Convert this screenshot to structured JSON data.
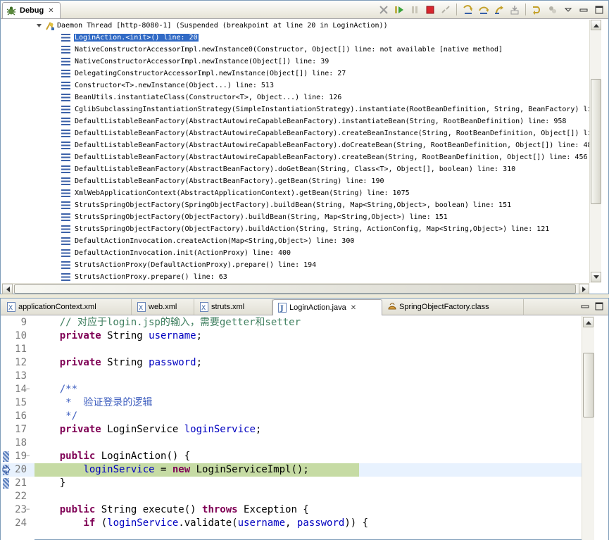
{
  "debug": {
    "tab_label": "Debug",
    "thread_label": "Daemon Thread [http-8080-1] (Suspended (breakpoint at line 20 in LoginAction))",
    "frames": [
      "LoginAction.<init>() line: 20",
      "NativeConstructorAccessorImpl.newInstance0(Constructor, Object[]) line: not available [native method]",
      "NativeConstructorAccessorImpl.newInstance(Object[]) line: 39",
      "DelegatingConstructorAccessorImpl.newInstance(Object[]) line: 27",
      "Constructor<T>.newInstance(Object...) line: 513",
      "BeanUtils.instantiateClass(Constructor<T>, Object...) line: 126",
      "CglibSubclassingInstantiationStrategy(SimpleInstantiationStrategy).instantiate(RootBeanDefinition, String, BeanFactory) li",
      "DefaultListableBeanFactory(AbstractAutowireCapableBeanFactory).instantiateBean(String, RootBeanDefinition) line: 958",
      "DefaultListableBeanFactory(AbstractAutowireCapableBeanFactory).createBeanInstance(String, RootBeanDefinition, Object[]) li",
      "DefaultListableBeanFactory(AbstractAutowireCapableBeanFactory).doCreateBean(String, RootBeanDefinition, Object[]) line: 48",
      "DefaultListableBeanFactory(AbstractAutowireCapableBeanFactory).createBean(String, RootBeanDefinition, Object[]) line: 456",
      "DefaultListableBeanFactory(AbstractBeanFactory).doGetBean(String, Class<T>, Object[], boolean) line: 310",
      "DefaultListableBeanFactory(AbstractBeanFactory).getBean(String) line: 190",
      "XmlWebApplicationContext(AbstractApplicationContext).getBean(String) line: 1075",
      "StrutsSpringObjectFactory(SpringObjectFactory).buildBean(String, Map<String,Object>, boolean) line: 151",
      "StrutsSpringObjectFactory(ObjectFactory).buildBean(String, Map<String,Object>) line: 151",
      "StrutsSpringObjectFactory(ObjectFactory).buildAction(String, String, ActionConfig, Map<String,Object>) line: 121",
      "DefaultActionInvocation.createAction(Map<String,Object>) line: 300",
      "DefaultActionInvocation.init(ActionProxy) line: 400",
      "StrutsActionProxy(DefaultActionProxy).prepare() line: 194",
      "StrutsActionProxy.prepare() line: 63"
    ],
    "selected_index": 0,
    "toolbar": [
      "remove-terminated-icon",
      "resume-icon",
      "suspend-icon",
      "terminate-icon",
      "disconnect-icon",
      "step-into-icon",
      "step-over-icon",
      "step-return-icon",
      "drop-to-frame-icon",
      "use-step-filters-icon",
      "view-menu-icon",
      "minimize-icon",
      "maximize-icon"
    ]
  },
  "editor": {
    "tabs": [
      {
        "label": "applicationContext.xml",
        "icon": "xml-file-icon",
        "active": false
      },
      {
        "label": "web.xml",
        "icon": "xml-file-icon",
        "active": false
      },
      {
        "label": "struts.xml",
        "icon": "xml-file-icon",
        "active": false
      },
      {
        "label": "LoginAction.java",
        "icon": "java-file-icon",
        "active": true
      },
      {
        "label": "SpringObjectFactory.class",
        "icon": "class-file-icon",
        "active": false
      }
    ],
    "lines": [
      {
        "num": "9",
        "tokens": [
          [
            "cmt",
            "    // 对应于login.jsp的输入，需要getter和setter"
          ]
        ]
      },
      {
        "num": "10",
        "tokens": [
          [
            "kw",
            "    private"
          ],
          [
            "plain",
            " String "
          ],
          [
            "fld",
            "username"
          ],
          [
            "plain",
            ";"
          ]
        ]
      },
      {
        "num": "11",
        "tokens": []
      },
      {
        "num": "12",
        "tokens": [
          [
            "kw",
            "    private"
          ],
          [
            "plain",
            " String "
          ],
          [
            "fld",
            "password"
          ],
          [
            "plain",
            ";"
          ]
        ]
      },
      {
        "num": "13",
        "tokens": []
      },
      {
        "num": "14",
        "fold": "−",
        "tokens": [
          [
            "jd",
            "    /**"
          ]
        ]
      },
      {
        "num": "15",
        "tokens": [
          [
            "jd",
            "     *  验证登录的逻辑"
          ]
        ]
      },
      {
        "num": "16",
        "tokens": [
          [
            "jd",
            "     */"
          ]
        ]
      },
      {
        "num": "17",
        "tokens": [
          [
            "kw",
            "    private"
          ],
          [
            "plain",
            " LoginService "
          ],
          [
            "fld",
            "loginService"
          ],
          [
            "plain",
            ";"
          ]
        ]
      },
      {
        "num": "18",
        "tokens": []
      },
      {
        "num": "19",
        "fold": "−",
        "marker": "bp",
        "tokens": [
          [
            "kw",
            "    public"
          ],
          [
            "plain",
            " LoginAction() {"
          ]
        ]
      },
      {
        "num": "20",
        "marker": "exec",
        "current": true,
        "tokens": [
          [
            "fld",
            "        loginService"
          ],
          [
            "plain",
            " = "
          ],
          [
            "kw",
            "new"
          ],
          [
            "plain",
            " LoginServiceImpl();"
          ]
        ]
      },
      {
        "num": "21",
        "marker": "bp",
        "tokens": [
          [
            "plain",
            "    }"
          ]
        ]
      },
      {
        "num": "22",
        "tokens": []
      },
      {
        "num": "23",
        "fold": "−",
        "tokens": [
          [
            "kw",
            "    public"
          ],
          [
            "plain",
            " String execute() "
          ],
          [
            "kw",
            "throws"
          ],
          [
            "plain",
            " Exception {"
          ]
        ]
      },
      {
        "num": "24",
        "tokens": [
          [
            "kw",
            "        if"
          ],
          [
            "plain",
            " ("
          ],
          [
            "fld",
            "loginService"
          ],
          [
            "plain",
            ".validate("
          ],
          [
            "fld",
            "username"
          ],
          [
            "plain",
            ", "
          ],
          [
            "fld",
            "password"
          ],
          [
            "plain",
            ")) {"
          ]
        ]
      }
    ]
  }
}
